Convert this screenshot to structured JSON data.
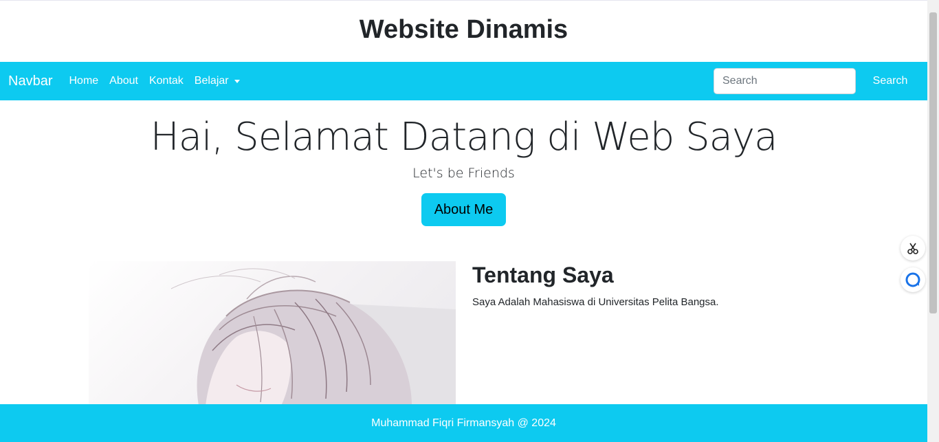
{
  "header": {
    "title": "Website Dinamis"
  },
  "navbar": {
    "brand": "Navbar",
    "links": [
      {
        "label": "Home"
      },
      {
        "label": "About"
      },
      {
        "label": "Kontak"
      },
      {
        "label": "Belajar"
      }
    ],
    "search": {
      "placeholder": "Search",
      "button_label": "Search"
    },
    "color": "#0dcaf0"
  },
  "hero": {
    "title": "Hai, Selamat Datang di Web Saya",
    "subtitle": "Let's be Friends",
    "button_label": "About Me"
  },
  "about": {
    "title": "Tentang Saya",
    "text": "Saya Adalah Mahasiswa di Universitas Pelita Bangsa.",
    "image_icon": "anime-portrait"
  },
  "footer": {
    "text": "Muhammad Fiqri Firmansyah @ 2024"
  },
  "floating": {
    "icons": [
      "scissors-icon",
      "chat-bubble-icon"
    ]
  }
}
